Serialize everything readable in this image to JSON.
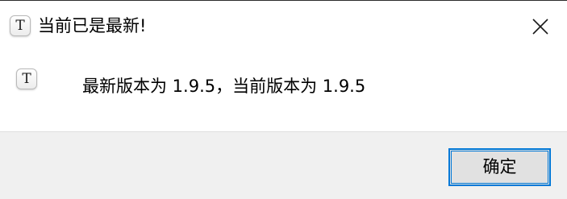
{
  "window": {
    "title": "当前已是最新!",
    "app_icon_glyph": "T",
    "close_icon": "close-icon"
  },
  "message": {
    "icon_glyph": "T",
    "text": "最新版本为 1.9.5，当前版本为 1.9.5"
  },
  "footer": {
    "ok_label": "确定"
  },
  "colors": {
    "accent": "#0078d7",
    "footer_bg": "#f0f0f0",
    "button_bg": "#e1e1e1"
  }
}
